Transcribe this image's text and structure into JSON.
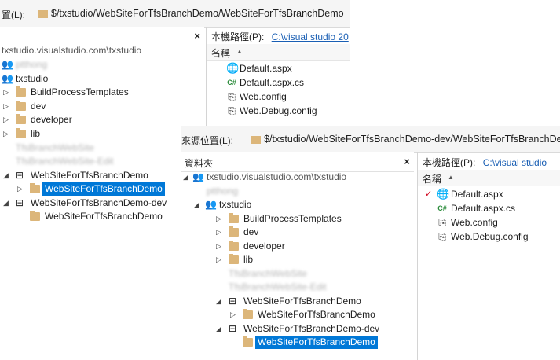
{
  "panel1": {
    "source_label": "置(L):",
    "source_path": "$/txstudio/WebSiteForTfsBranchDemo/WebSiteForTfsBranchDemo",
    "folder_header": "",
    "close": "×",
    "local_path_label": "本機路徑(P):",
    "local_path_link": "C:\\visual studio 20",
    "name_column": "名稱",
    "sort": "▲",
    "tree": {
      "server": "txstudio.visualstudio.com\\txstudio",
      "blurred1": "ptthong",
      "project": "txstudio",
      "items": [
        "BuildProcessTemplates",
        "dev",
        "developer",
        "lib"
      ],
      "blurred2": "TfsBranchWebSite",
      "blurred3": "TfsBranchWebSite-Edit",
      "branch1": "WebSiteForTfsBranchDemo",
      "branch1_child": "WebSiteForTfsBranchDemo",
      "branch2": "WebSiteForTfsBranchDemo-dev",
      "branch2_child": "WebSiteForTfsBranchDemo"
    },
    "files": [
      "Default.aspx",
      "Default.aspx.cs",
      "Web.config",
      "Web.Debug.config"
    ]
  },
  "panel2": {
    "source_label": "來源位置(L):",
    "source_path": "$/txstudio/WebSiteForTfsBranchDemo-dev/WebSiteForTfsBranchDe",
    "folder_header": "資料夾",
    "close": "×",
    "local_path_label": "本機路徑(P):",
    "local_path_link": "C:\\visual studio",
    "name_column": "名稱",
    "sort": "▲",
    "tree": {
      "server": "txstudio.visualstudio.com\\txstudio",
      "blurred1": "ptthong",
      "project": "txstudio",
      "items": [
        "BuildProcessTemplates",
        "dev",
        "developer",
        "lib"
      ],
      "blurred2": "TfsBranchWebSite",
      "blurred3": "TfsBranchWebSite-Edit",
      "branch1": "WebSiteForTfsBranchDemo",
      "branch1_child": "WebSiteForTfsBranchDemo",
      "branch2": "WebSiteForTfsBranchDemo-dev",
      "branch2_child": "WebSiteForTfsBranchDemo"
    },
    "files": [
      "Default.aspx",
      "Default.aspx.cs",
      "Web.config",
      "Web.Debug.config"
    ],
    "pending_mark": "✓"
  },
  "colors": {
    "selection": "#0078d7",
    "folder": "#dcb67a",
    "link": "#1a5fb4"
  },
  "icons": {
    "folder": "folder-icon",
    "branch": "branch-icon",
    "team": "team-icon",
    "globe": "web-page-icon",
    "cs": "csharp-file-icon",
    "config": "config-file-icon"
  }
}
